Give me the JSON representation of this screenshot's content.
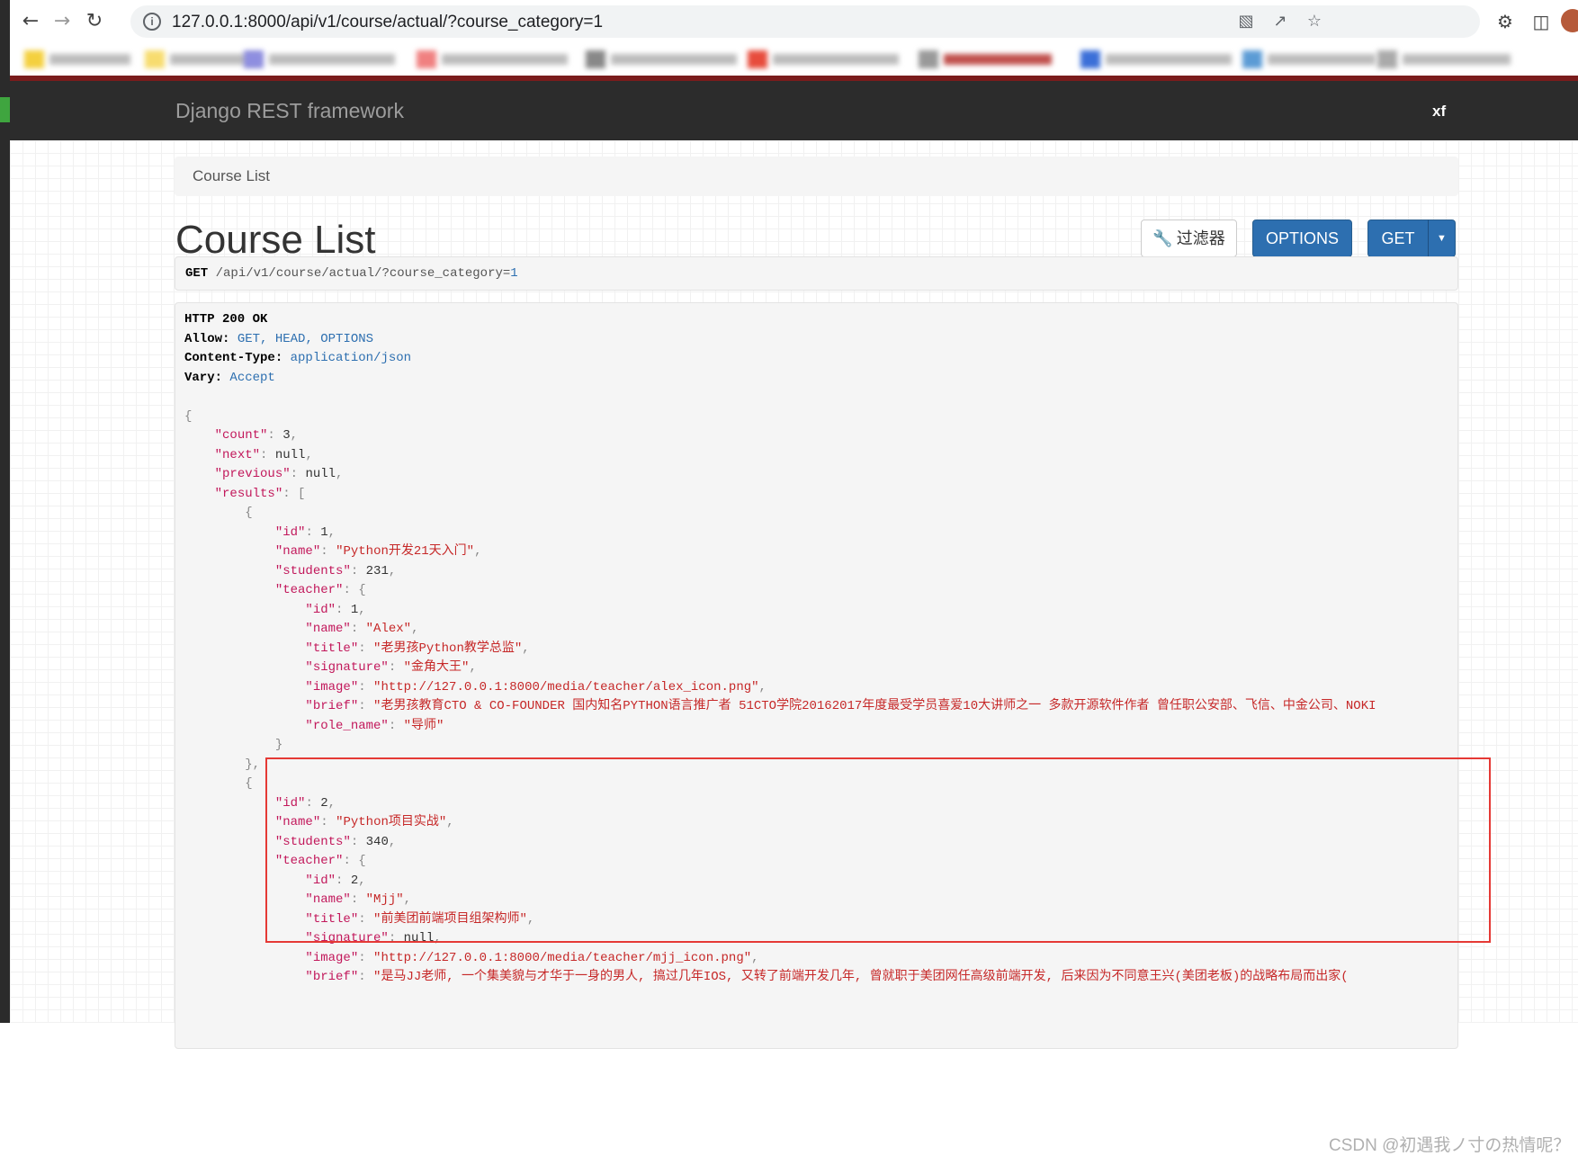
{
  "browser": {
    "url": "127.0.0.1:8000/api/v1/course/actual/?course_category=1",
    "icons": [
      "back-icon",
      "forward-icon",
      "reload-icon",
      "info-icon",
      "translate-icon",
      "share-icon",
      "star-icon",
      "extensions-icon",
      "sidepanel-icon"
    ]
  },
  "navbar": {
    "brand": "Django REST framework",
    "user": "xf"
  },
  "breadcrumb": "Course List",
  "page_title": "Course List",
  "buttons": {
    "filter": "过滤器",
    "options": "OPTIONS",
    "get": "GET"
  },
  "request": {
    "method": "GET",
    "path": "/api/v1/course/actual/?course_category=",
    "param_value": "1"
  },
  "response": {
    "status": "HTTP 200 OK",
    "headers": [
      {
        "name": "Allow:",
        "value": "GET, HEAD, OPTIONS"
      },
      {
        "name": "Content-Type:",
        "value": "application/json"
      },
      {
        "name": "Vary:",
        "value": "Accept"
      }
    ],
    "body": {
      "count": "3",
      "next": "null",
      "previous": "null",
      "results": [
        {
          "id": "1",
          "name": "\"Python开发21天入门\"",
          "students": "231",
          "teacher": {
            "id": "1",
            "name": "\"Alex\"",
            "title": "\"老男孩Python教学总监\"",
            "signature": "\"金角大王\"",
            "image": "\"http://127.0.0.1:8000/media/teacher/alex_icon.png\"",
            "brief": "\"老男孩教育CTO & CO-FOUNDER 国内知名PYTHON语言推广者 51CTO学院20162017年度最受学员喜爱10大讲师之一 多款开源软件作者 曾任职公安部、飞信、中金公司、NOKI",
            "role_name": "\"导师\""
          }
        },
        {
          "id": "2",
          "name": "\"Python项目实战\"",
          "students": "340",
          "teacher": {
            "id": "2",
            "name": "\"Mjj\"",
            "title": "\"前美团前端项目组架构师\"",
            "signature": "null",
            "image": "\"http://127.0.0.1:8000/media/teacher/mjj_icon.png\"",
            "brief": "\"是马JJ老师, 一个集美貌与才华于一身的男人, 搞过几年IOS, 又转了前端开发几年, 曾就职于美团网任高级前端开发, 后来因为不同意王兴(美团老板)的战略布局而出家("
          }
        }
      ]
    }
  },
  "watermark": "CSDN @初遇我ノ寸の热情呢？"
}
